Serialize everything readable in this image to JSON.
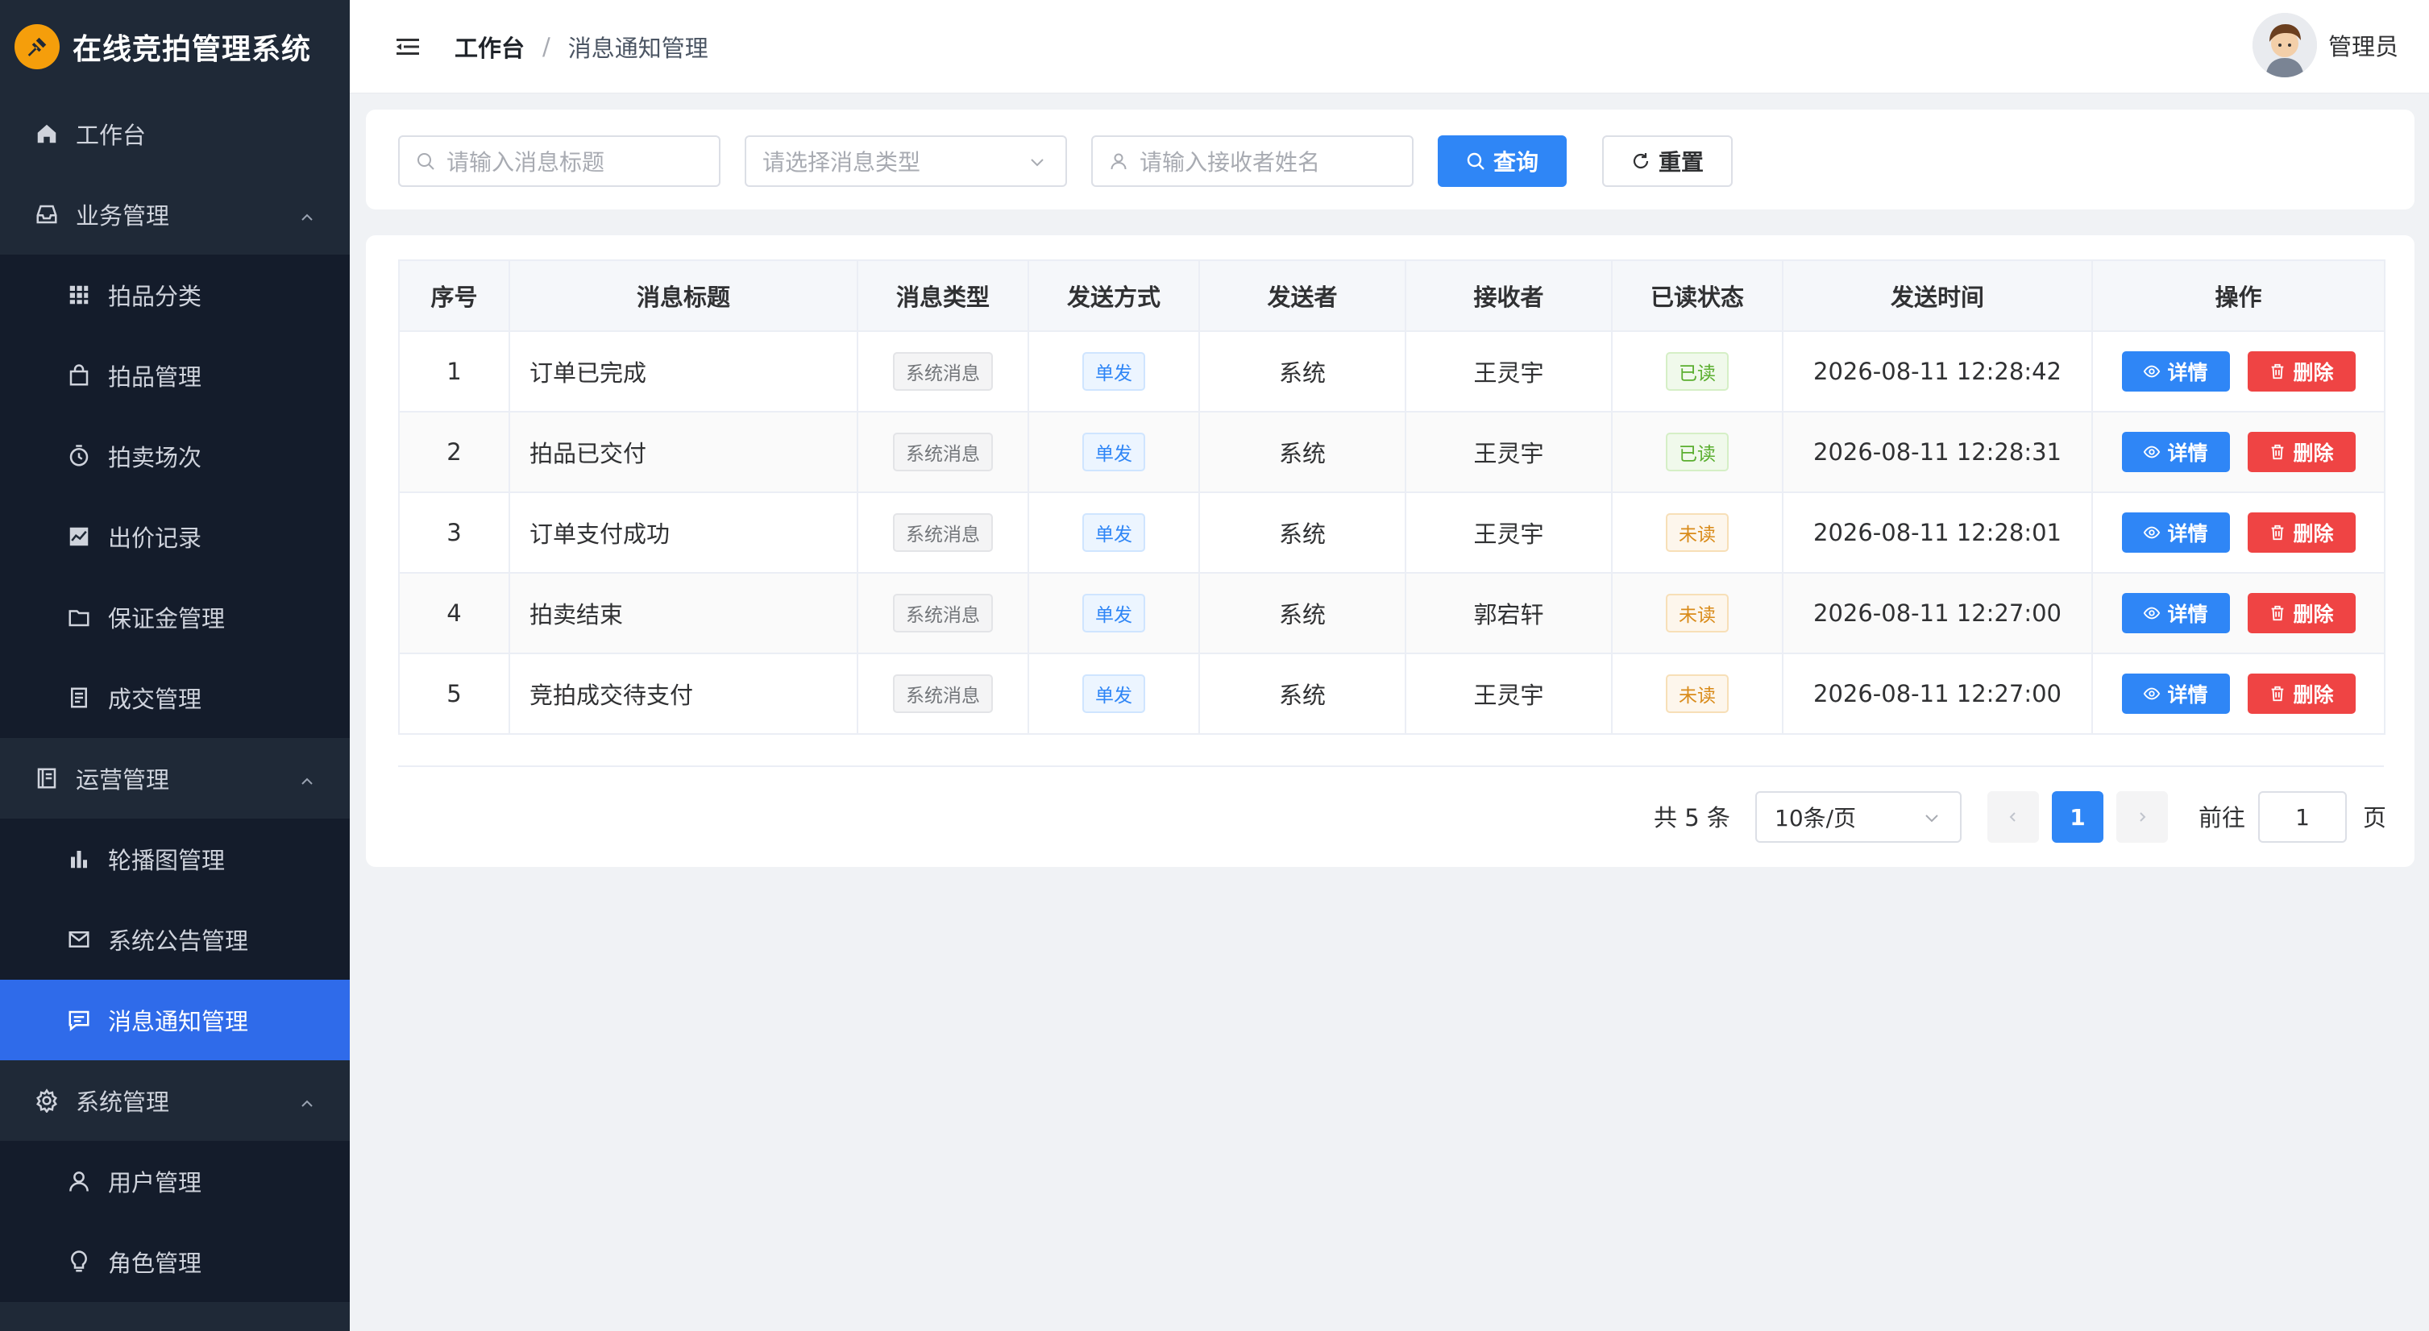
{
  "brand": {
    "title": "在线竞拍管理系统"
  },
  "sidebar": {
    "items": [
      {
        "label": "工作台",
        "icon": "home-icon",
        "level": "top"
      },
      {
        "label": "业务管理",
        "icon": "inbox-icon",
        "level": "top",
        "expanded": true
      },
      {
        "label": "拍品分类",
        "icon": "grid-icon",
        "level": "sub"
      },
      {
        "label": "拍品管理",
        "icon": "bag-icon",
        "level": "sub"
      },
      {
        "label": "拍卖场次",
        "icon": "timer-icon",
        "level": "sub"
      },
      {
        "label": "出价记录",
        "icon": "chart-line-icon",
        "level": "sub"
      },
      {
        "label": "保证金管理",
        "icon": "folder-icon",
        "level": "sub"
      },
      {
        "label": "成交管理",
        "icon": "document-icon",
        "level": "sub"
      },
      {
        "label": "运营管理",
        "icon": "notebook-icon",
        "level": "top",
        "expanded": true
      },
      {
        "label": "轮播图管理",
        "icon": "bar-chart-icon",
        "level": "sub"
      },
      {
        "label": "系统公告管理",
        "icon": "mail-icon",
        "level": "sub"
      },
      {
        "label": "消息通知管理",
        "icon": "message-icon",
        "level": "sub",
        "active": true
      },
      {
        "label": "系统管理",
        "icon": "setting-icon",
        "level": "top",
        "expanded": true
      },
      {
        "label": "用户管理",
        "icon": "user-icon",
        "level": "sub"
      },
      {
        "label": "角色管理",
        "icon": "bulb-icon",
        "level": "sub"
      }
    ]
  },
  "header": {
    "breadcrumb_root": "工作台",
    "breadcrumb_sep": "/",
    "breadcrumb_current": "消息通知管理",
    "user_name": "管理员"
  },
  "filters": {
    "title_placeholder": "请输入消息标题",
    "type_placeholder": "请选择消息类型",
    "receiver_placeholder": "请输入接收者姓名",
    "search_label": "查询",
    "reset_label": "重置"
  },
  "table": {
    "columns": [
      "序号",
      "消息标题",
      "消息类型",
      "发送方式",
      "发送者",
      "接收者",
      "已读状态",
      "发送时间",
      "操作"
    ],
    "rows": [
      {
        "index": "1",
        "title": "订单已完成",
        "type": "系统消息",
        "method": "单发",
        "sender": "系统",
        "receiver": "王灵宇",
        "status": "已读",
        "time": "2026-08-11 12:28:42"
      },
      {
        "index": "2",
        "title": "拍品已交付",
        "type": "系统消息",
        "method": "单发",
        "sender": "系统",
        "receiver": "王灵宇",
        "status": "已读",
        "time": "2026-08-11 12:28:31"
      },
      {
        "index": "3",
        "title": "订单支付成功",
        "type": "系统消息",
        "method": "单发",
        "sender": "系统",
        "receiver": "王灵宇",
        "status": "未读",
        "time": "2026-08-11 12:28:01"
      },
      {
        "index": "4",
        "title": "拍卖结束",
        "type": "系统消息",
        "method": "单发",
        "sender": "系统",
        "receiver": "郭宕轩",
        "status": "未读",
        "time": "2026-08-11 12:27:00"
      },
      {
        "index": "5",
        "title": "竞拍成交待支付",
        "type": "系统消息",
        "method": "单发",
        "sender": "系统",
        "receiver": "王灵宇",
        "status": "未读",
        "time": "2026-08-11 12:27:00"
      }
    ],
    "detail_label": "详情",
    "delete_label": "删除"
  },
  "pagination": {
    "total_text": "共 5 条",
    "page_size": "10条/页",
    "current_page": "1",
    "goto_label": "前往",
    "goto_value": "1",
    "page_unit": "页"
  },
  "colors": {
    "sidebar_bg": "#1f2937",
    "active_bg": "#2f6bea",
    "primary": "#2f86f6",
    "danger": "#ef4444",
    "read_green": "#5aae2f",
    "unread_orange": "#d98b1a",
    "brand_logo": "#f59e0b"
  }
}
